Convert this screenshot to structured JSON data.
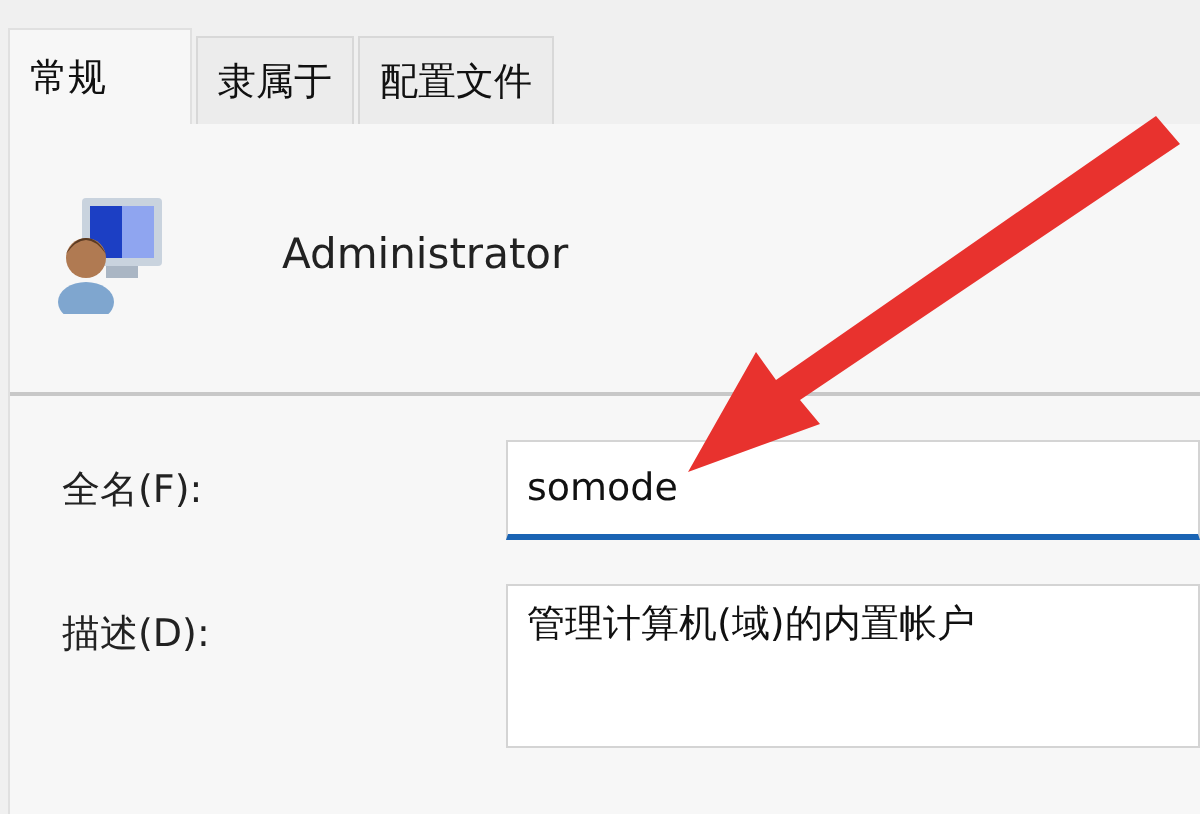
{
  "tabs": [
    {
      "label": "常规",
      "selected": true
    },
    {
      "label": "隶属于",
      "selected": false
    },
    {
      "label": "配置文件",
      "selected": false
    }
  ],
  "user": {
    "name": "Administrator"
  },
  "fields": [
    {
      "kind": "line",
      "label": "全名(F):",
      "value": "somode",
      "focused": true
    },
    {
      "kind": "area",
      "label": "描述(D):",
      "value": "管理计算机(域)的内置帐户",
      "focused": false
    }
  ]
}
